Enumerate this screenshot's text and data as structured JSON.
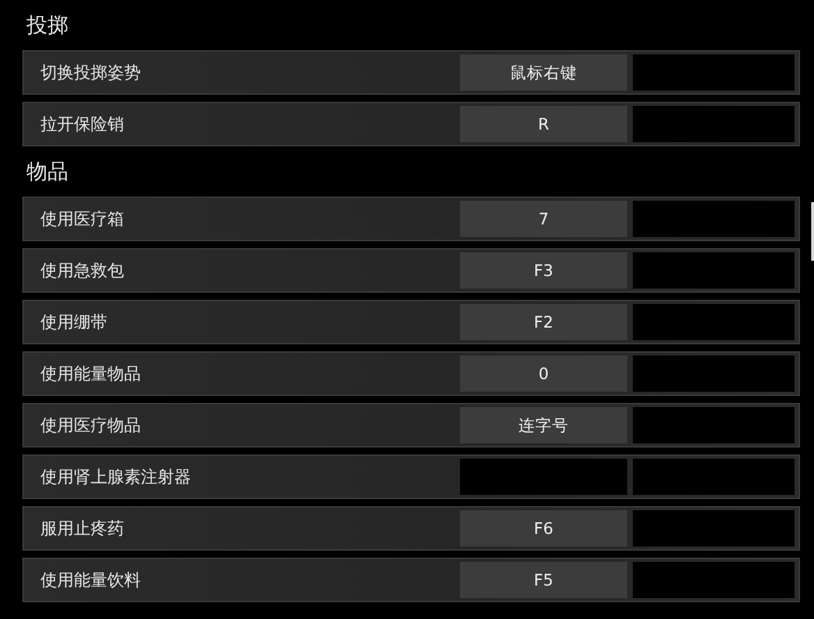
{
  "sections": [
    {
      "title": "投掷",
      "bindings": [
        {
          "action": "切换投掷姿势",
          "key": "鼠标右键"
        },
        {
          "action": "拉开保险销",
          "key": "R"
        }
      ]
    },
    {
      "title": "物品",
      "bindings": [
        {
          "action": "使用医疗箱",
          "key": "7"
        },
        {
          "action": "使用急救包",
          "key": "F3"
        },
        {
          "action": "使用绷带",
          "key": "F2"
        },
        {
          "action": "使用能量物品",
          "key": "0"
        },
        {
          "action": "使用医疗物品",
          "key": "连字号"
        },
        {
          "action": "使用肾上腺素注射器"
        },
        {
          "action": "服用止疼药",
          "key": "F6"
        },
        {
          "action": "使用能量饮料",
          "key": "F5"
        }
      ]
    }
  ]
}
